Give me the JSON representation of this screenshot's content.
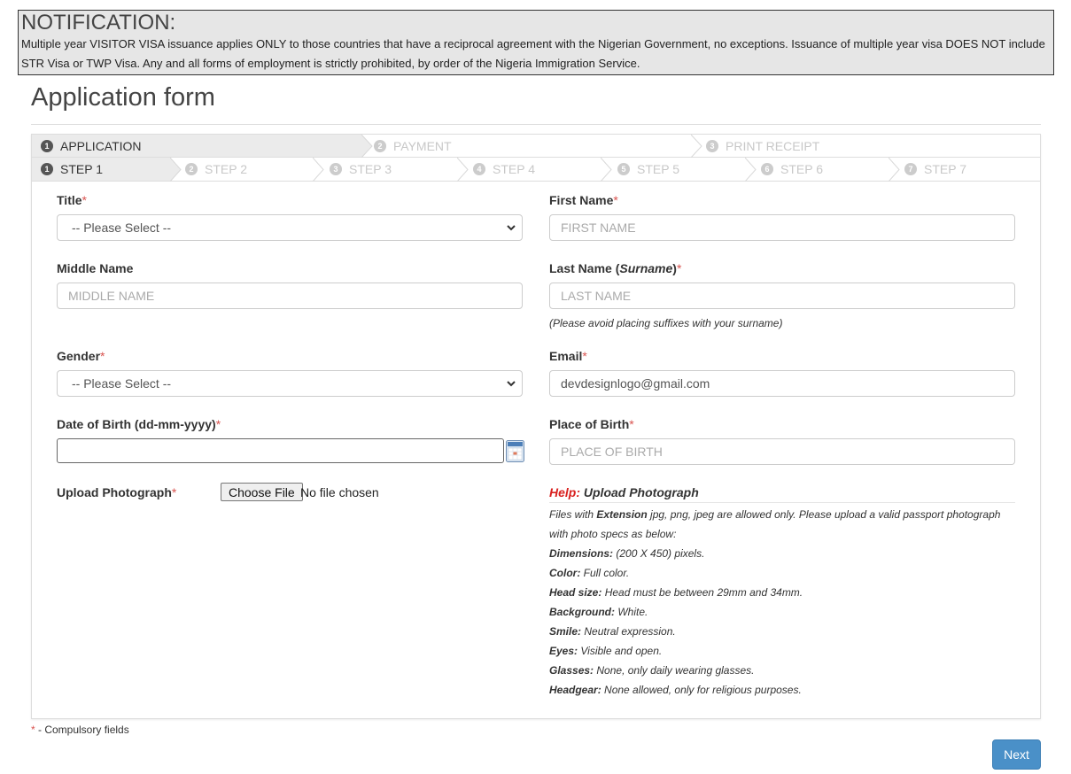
{
  "notification": {
    "title": "NOTIFICATION:",
    "line1": "Multiple year VISITOR VISA issuance applies ONLY to those countries that have a reciprocal agreement with the Nigerian Government, no exceptions. Issuance of multiple year visa DOES NOT include",
    "line2": "STR Visa or TWP Visa. Any and all forms of employment is strictly prohibited, by order of the Nigeria Immigration Service."
  },
  "page_title": "Application form",
  "phases": [
    {
      "num": "1",
      "label": "APPLICATION"
    },
    {
      "num": "2",
      "label": "PAYMENT"
    },
    {
      "num": "3",
      "label": "PRINT RECEIPT"
    }
  ],
  "steps": [
    {
      "num": "1",
      "label": "STEP 1"
    },
    {
      "num": "2",
      "label": "STEP 2"
    },
    {
      "num": "3",
      "label": "STEP 3"
    },
    {
      "num": "4",
      "label": "STEP 4"
    },
    {
      "num": "5",
      "label": "STEP 5"
    },
    {
      "num": "6",
      "label": "STEP 6"
    },
    {
      "num": "7",
      "label": "STEP 7"
    }
  ],
  "form": {
    "title": {
      "label": "Title",
      "value": "-- Please Select --"
    },
    "first_name": {
      "label": "First Name",
      "placeholder": "FIRST NAME"
    },
    "middle_name": {
      "label": "Middle Name",
      "placeholder": "MIDDLE NAME"
    },
    "last_name": {
      "label_prefix": "Last Name (",
      "label_italic": "Surname",
      "label_suffix": ")",
      "placeholder": "LAST NAME",
      "hint": "(Please avoid placing suffixes with your surname)"
    },
    "gender": {
      "label": "Gender",
      "value": "-- Please Select --"
    },
    "email": {
      "label": "Email",
      "value": "devdesignlogo@gmail.com"
    },
    "dob": {
      "label": "Date of Birth (dd-mm-yyyy)",
      "value": ""
    },
    "place_of_birth": {
      "label": "Place of Birth",
      "placeholder": "PLACE OF BIRTH"
    },
    "photo": {
      "label": "Upload Photograph",
      "button": "Choose File",
      "status": "No file chosen"
    }
  },
  "required_mark": "*",
  "help": {
    "prefix": "Help:",
    "title": "Upload Photograph",
    "intro_a": "Files with ",
    "intro_b": "Extension",
    "intro_c": " jpg, png, jpeg are allowed only. Please upload a valid passport photograph",
    "intro_2": "with photo specs as below:",
    "specs": [
      {
        "key": "Dimensions:",
        "value": " (200 X 450) pixels."
      },
      {
        "key": "Color:",
        "value": " Full color."
      },
      {
        "key": "Head size:",
        "value": " Head must be between 29mm and 34mm."
      },
      {
        "key": "Background:",
        "value": " White."
      },
      {
        "key": "Smile:",
        "value": " Neutral expression."
      },
      {
        "key": "Eyes:",
        "value": " Visible and open."
      },
      {
        "key": "Glasses:",
        "value": " None, only daily wearing glasses."
      },
      {
        "key": "Headgear:",
        "value": " None allowed, only for religious purposes."
      }
    ]
  },
  "footnote": " - Compulsory fields",
  "next_button": "Next",
  "colors": {
    "primary": "#4a90c8",
    "required": "#d9534f",
    "help": "#d9211f"
  }
}
